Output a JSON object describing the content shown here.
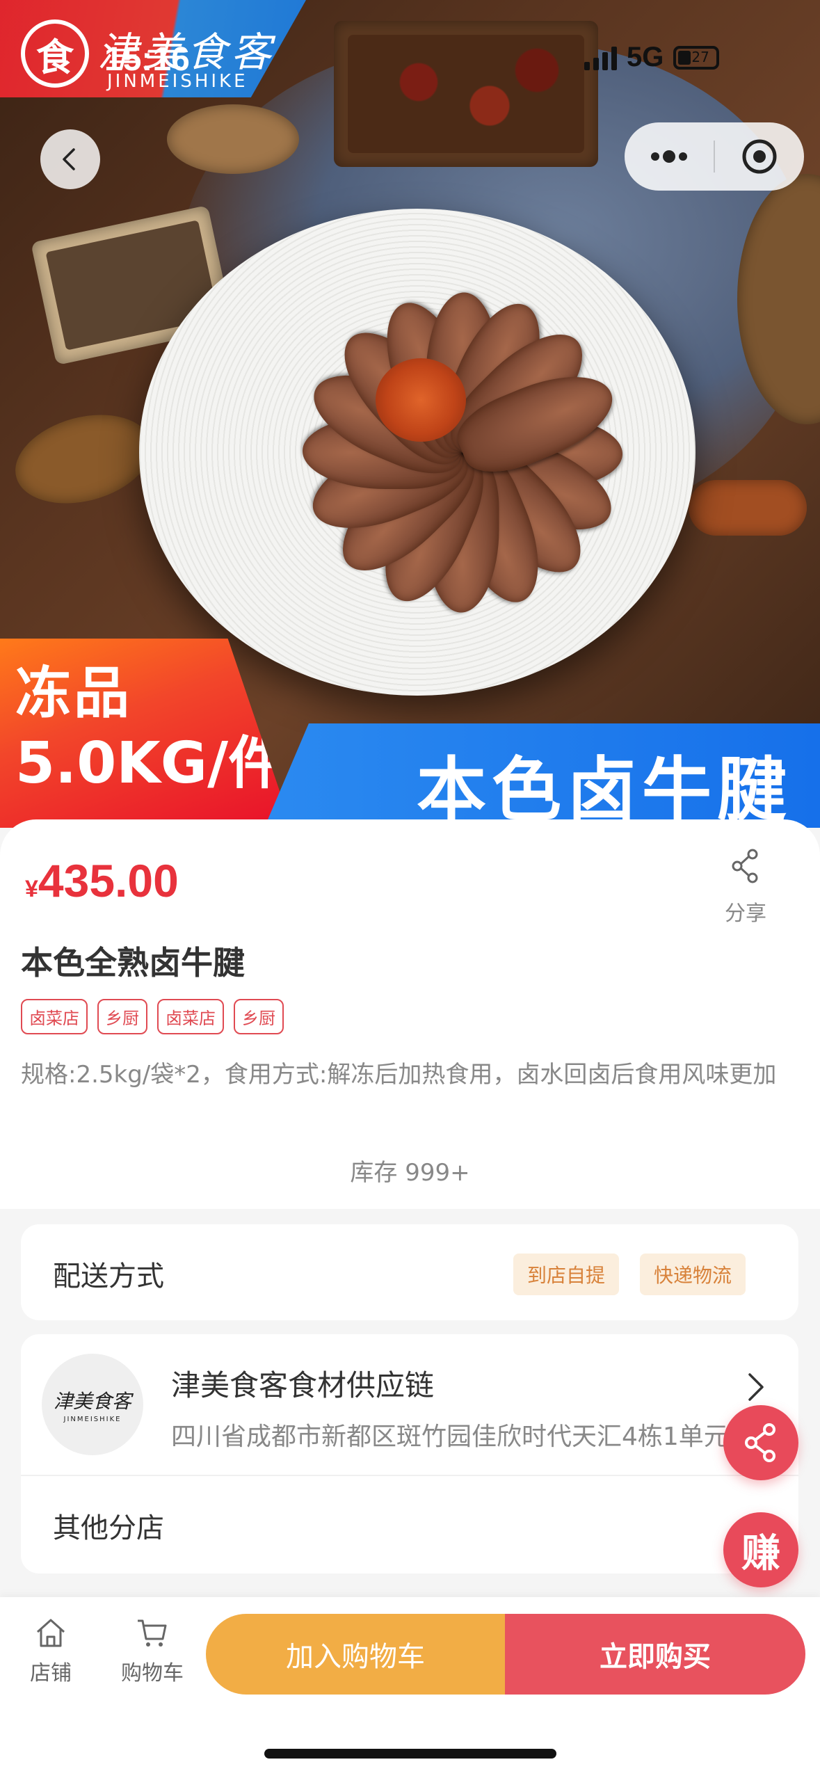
{
  "status_bar": {
    "time": "15:16",
    "network": "5G",
    "battery": "27"
  },
  "brand": {
    "name_cn": "津美食客",
    "name_en": "JINMEISHIKE"
  },
  "hero": {
    "promo_left_line1": "冻品",
    "promo_left_line2": "5.0KG/件",
    "promo_right": "本色卤牛腱"
  },
  "product": {
    "currency": "¥",
    "price": "435.00",
    "share_label": "分享",
    "title": "本色全熟卤牛腱",
    "tags": [
      "卤菜店",
      "乡厨",
      "卤菜店",
      "乡厨"
    ],
    "description": "规格:2.5kg/袋*2，食用方式:解冻后加热食用，卤水回卤后食用风味更加",
    "stock": "库存 999+"
  },
  "delivery": {
    "label": "配送方式",
    "options": [
      "到店自提",
      "快递物流"
    ]
  },
  "store": {
    "avatar_cn": "津美食客",
    "avatar_en": "JINMEISHIKE",
    "name": "津美食客食材供应链",
    "address": "四川省成都市新都区斑竹园佳欣时代天汇4栋1单元",
    "other_branches": "其他分店"
  },
  "floating": {
    "earn_label": "赚"
  },
  "bottom_bar": {
    "store_label": "店铺",
    "cart_label": "购物车",
    "add_to_cart": "加入购物车",
    "buy_now": "立即购买"
  },
  "colors": {
    "price_red": "#e8323c",
    "cart_orange": "#f2ad45",
    "buy_red": "#e8525e",
    "tag_red": "#e04a52",
    "delivery_tag_bg": "#fbeedd"
  }
}
